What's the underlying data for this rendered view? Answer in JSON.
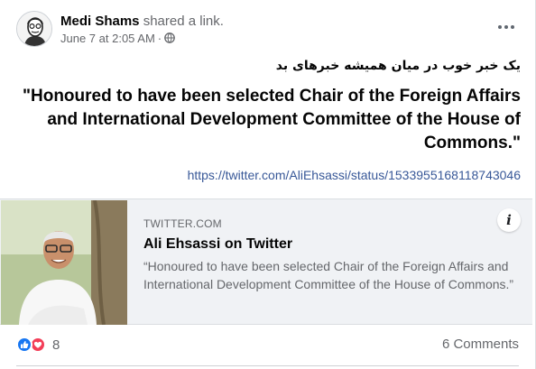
{
  "post": {
    "author": "Medi Shams",
    "action": "shared a link.",
    "date": "June 7 at 2:05 AM",
    "separator": "·",
    "privacy_icon": "globe-icon",
    "more_icon": "more-horizontal-icon",
    "persian_text": "یک خبر خوب در میان همیشه خبرهای بد",
    "quote_text": "\"Honoured to have been selected Chair of the Foreign Affairs and International Development Committee of the House of Commons.\"",
    "link_url": "https://twitter.com/AliEhsassi/status/1533955168118743046"
  },
  "card": {
    "domain": "TWITTER.COM",
    "title": "Ali Ehsassi on Twitter",
    "description": "“Honoured to have been selected Chair of the Foreign Affairs and International Development Committee of the House of Commons.”",
    "info_label": "i"
  },
  "footer": {
    "reaction_count": "8",
    "comments": "6 Comments",
    "reaction_icons": [
      "like-icon",
      "love-icon"
    ]
  },
  "colors": {
    "link": "#385898",
    "secondary_text": "#65676b",
    "like_blue": "#1877f2",
    "love_red": "#f33e58",
    "card_bg": "#f0f2f5"
  }
}
